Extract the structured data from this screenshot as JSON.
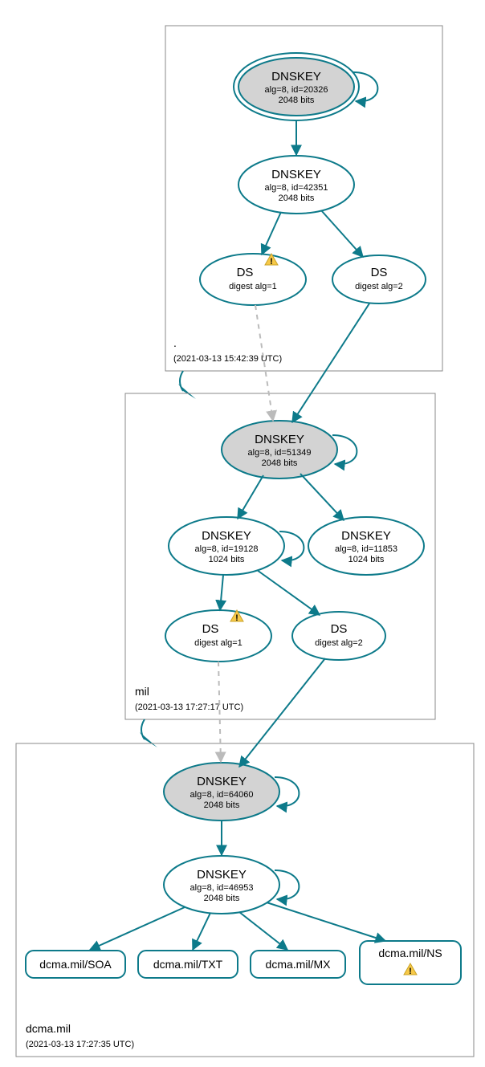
{
  "zones": {
    "root": {
      "name": ".",
      "timestamp": "(2021-03-13 15:42:39 UTC)"
    },
    "mil": {
      "name": "mil",
      "timestamp": "(2021-03-13 17:27:17 UTC)"
    },
    "dcma": {
      "name": "dcma.mil",
      "timestamp": "(2021-03-13 17:27:35 UTC)"
    }
  },
  "colors": {
    "stroke": "#0d7a8a",
    "ksk_fill": "#d3d3d3",
    "dashed": "#bbb",
    "warn": "#f7c948"
  },
  "nodes": {
    "root_ksk": {
      "title": "DNSKEY",
      "line1": "alg=8, id=20326",
      "line2": "2048 bits"
    },
    "root_zsk": {
      "title": "DNSKEY",
      "line1": "alg=8, id=42351",
      "line2": "2048 bits"
    },
    "root_ds1": {
      "title": "DS",
      "line1": "digest alg=1",
      "warn": true
    },
    "root_ds2": {
      "title": "DS",
      "line1": "digest alg=2"
    },
    "mil_ksk": {
      "title": "DNSKEY",
      "line1": "alg=8, id=51349",
      "line2": "2048 bits"
    },
    "mil_zsk1": {
      "title": "DNSKEY",
      "line1": "alg=8, id=19128",
      "line2": "1024 bits"
    },
    "mil_zsk2": {
      "title": "DNSKEY",
      "line1": "alg=8, id=11853",
      "line2": "1024 bits"
    },
    "mil_ds1": {
      "title": "DS",
      "line1": "digest alg=1",
      "warn": true
    },
    "mil_ds2": {
      "title": "DS",
      "line1": "digest alg=2"
    },
    "dcma_ksk": {
      "title": "DNSKEY",
      "line1": "alg=8, id=64060",
      "line2": "2048 bits"
    },
    "dcma_zsk": {
      "title": "DNSKEY",
      "line1": "alg=8, id=46953",
      "line2": "2048 bits"
    },
    "rr_soa": {
      "label": "dcma.mil/SOA"
    },
    "rr_txt": {
      "label": "dcma.mil/TXT"
    },
    "rr_mx": {
      "label": "dcma.mil/MX"
    },
    "rr_ns": {
      "label": "dcma.mil/NS",
      "warn": true
    }
  }
}
